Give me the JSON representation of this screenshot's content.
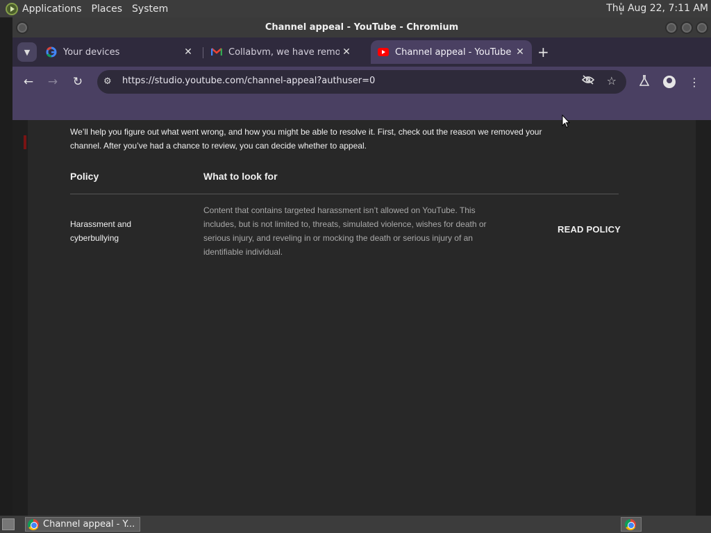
{
  "top_panel": {
    "menus": [
      "Applications",
      "Places",
      "System"
    ],
    "clock": "Thu Aug 22,  7:11 AM"
  },
  "window": {
    "title": "Channel appeal - YouTube - Chromium"
  },
  "tabs": [
    {
      "title": "Your devices",
      "icon": "google-icon",
      "active": false
    },
    {
      "title": "Collabvm, we have removed",
      "icon": "gmail-icon",
      "active": false
    },
    {
      "title": "Channel appeal - YouTube",
      "icon": "youtube-icon",
      "active": true
    }
  ],
  "toolbar": {
    "url": "https://studio.youtube.com/channel-appeal?authuser=0"
  },
  "page": {
    "intro": "We’ll help you figure out what went wrong, and how you might be able to resolve it. First, check out the reason we removed your channel. After you’ve had a chance to review, you can decide whether to appeal.",
    "col_policy": "Policy",
    "col_what": "What to look for",
    "policy_name": "Harassment and cyberbullying",
    "policy_desc": "Content that contains targeted harassment isn’t allowed on YouTube. This includes, but is not limited to, threats, simulated violence, wishes for death or serious injury, and reveling in or mocking the death or serious injury of an identifiable individual.",
    "read_policy": "READ POLICY"
  },
  "taskbar": {
    "task_label": "Channel appeal - Y..."
  },
  "colors": {
    "tab_active": "#4a4062",
    "tabstrip": "#2f2a3d",
    "page_bg": "#282828"
  }
}
